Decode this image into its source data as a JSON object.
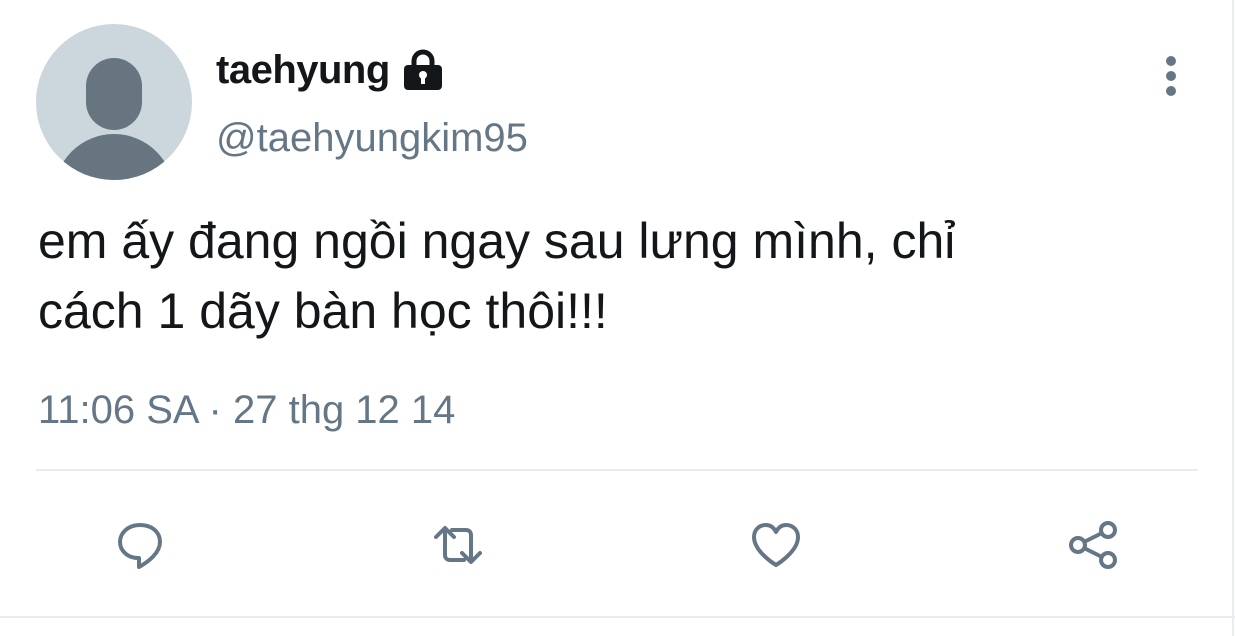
{
  "user": {
    "display_name": "taehyung",
    "handle": "@taehyungkim95",
    "protected_icon": "lock-icon",
    "avatar": "default-avatar"
  },
  "tweet": {
    "text": "em ấy đang ngồi ngay sau lưng mình, chỉ\ncách 1 dãy bàn học thôi!!!",
    "time": "11:06 SA",
    "separator": "·",
    "date": "27 thg 12 14"
  },
  "actions": [
    {
      "name": "reply",
      "icon": "reply-icon"
    },
    {
      "name": "retweet",
      "icon": "retweet-icon"
    },
    {
      "name": "like",
      "icon": "heart-icon"
    },
    {
      "name": "share",
      "icon": "share-icon"
    }
  ],
  "colors": {
    "text_primary": "#14171a",
    "text_secondary": "#657786",
    "avatar_bg": "#ccd6dd",
    "avatar_fg": "#66757f",
    "divider": "#e6ecf0"
  }
}
